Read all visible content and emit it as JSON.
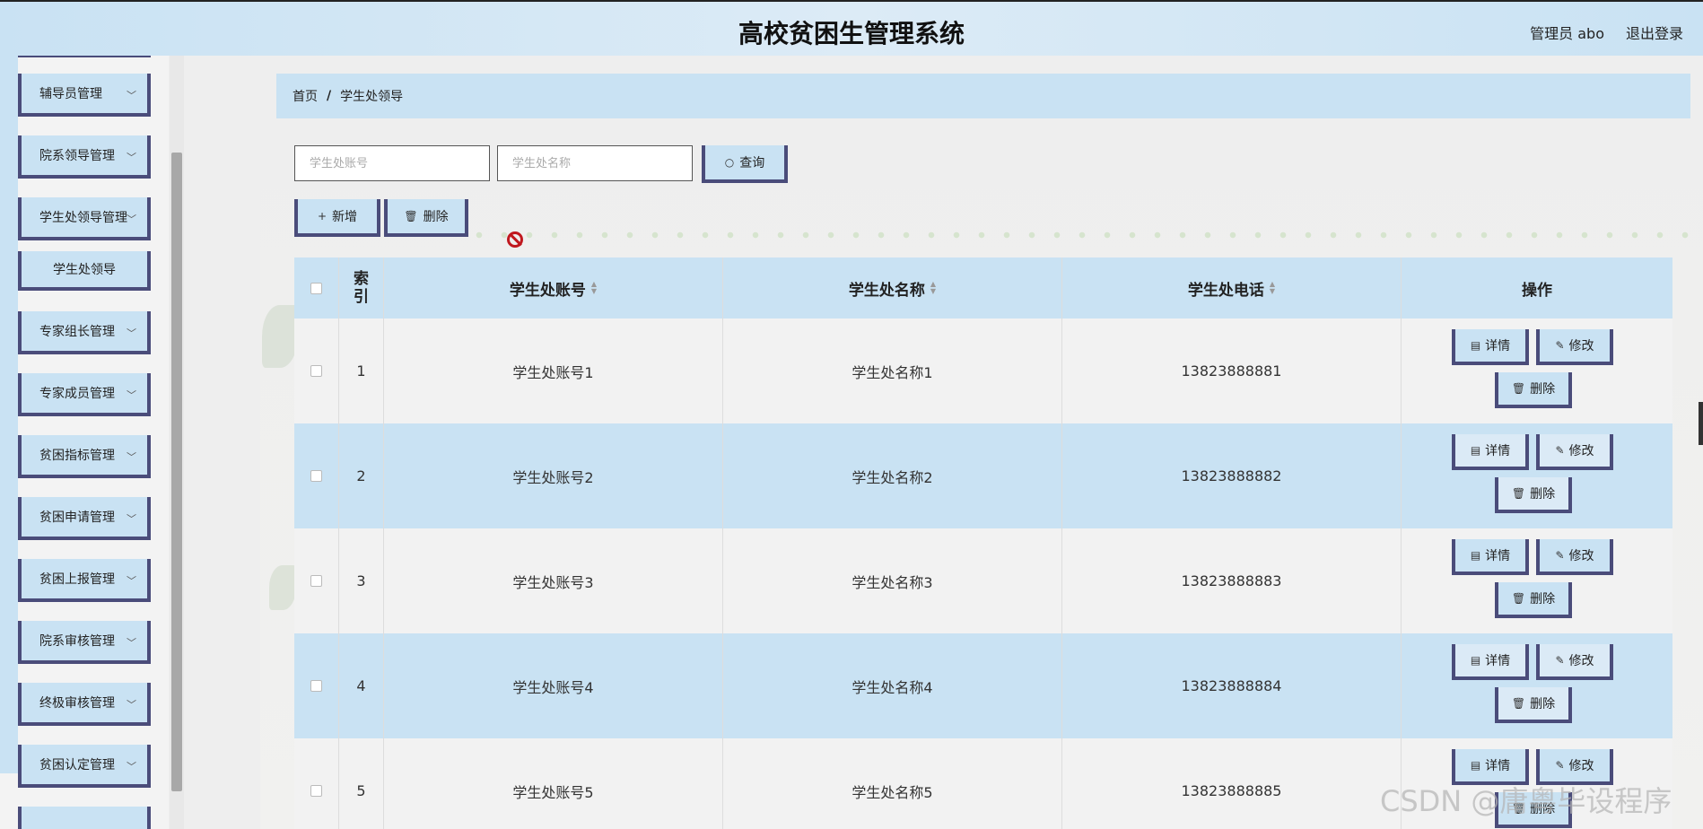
{
  "header": {
    "title": "高校贫困生管理系统",
    "user_label": "管理员 abo",
    "logout_label": "退出登录"
  },
  "sidebar": {
    "items": [
      {
        "label": "辅导员管理"
      },
      {
        "label": "院系领导管理"
      },
      {
        "label": "学生处领导管理"
      },
      {
        "label": "专家组长管理"
      },
      {
        "label": "专家成员管理"
      },
      {
        "label": "贫困指标管理"
      },
      {
        "label": "贫困申请管理"
      },
      {
        "label": "贫困上报管理"
      },
      {
        "label": "院系审核管理"
      },
      {
        "label": "终极审核管理"
      },
      {
        "label": "贫困认定管理"
      }
    ],
    "sub_item": "学生处领导"
  },
  "breadcrumb": {
    "home": "首页",
    "separator": "/",
    "current": "学生处领导"
  },
  "search": {
    "account_placeholder": "学生处账号",
    "name_placeholder": "学生处名称",
    "query_label": "查询"
  },
  "toolbar": {
    "add_label": "新增",
    "delete_label": "删除"
  },
  "table": {
    "headers": {
      "index": "索引",
      "account": "学生处账号",
      "name": "学生处名称",
      "phone": "学生处电话",
      "ops": "操作"
    },
    "rows": [
      {
        "index": "1",
        "account": "学生处账号1",
        "name": "学生处名称1",
        "phone": "13823888881"
      },
      {
        "index": "2",
        "account": "学生处账号2",
        "name": "学生处名称2",
        "phone": "13823888882"
      },
      {
        "index": "3",
        "account": "学生处账号3",
        "name": "学生处名称3",
        "phone": "13823888883"
      },
      {
        "index": "4",
        "account": "学生处账号4",
        "name": "学生处名称4",
        "phone": "13823888884"
      },
      {
        "index": "5",
        "account": "学生处账号5",
        "name": "学生处名称5",
        "phone": "13823888885"
      }
    ],
    "op_labels": {
      "detail": "详情",
      "edit": "修改",
      "delete": "删除"
    }
  },
  "watermark": "CSDN @庸粤毕设程序",
  "colors": {
    "accent": "#c9e2f3",
    "border": "#4a4c7a"
  }
}
